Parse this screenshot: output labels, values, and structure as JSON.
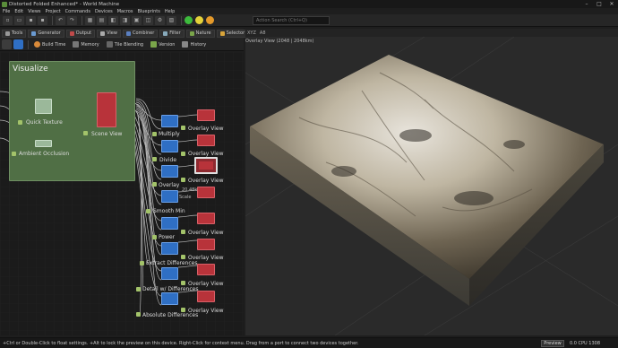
{
  "window": {
    "title": "Distorted Folded Enhanced* - World Machine"
  },
  "menu": [
    "File",
    "Edit",
    "Views",
    "Project",
    "Commands",
    "Devices",
    "Macros",
    "Blueprints",
    "Help"
  ],
  "search": {
    "placeholder": "Action Search (Ctrl+Q)"
  },
  "tabs": [
    "Tools",
    "Generator",
    "Output",
    "View",
    "Combiner",
    "Filter",
    "Nature",
    "Selector"
  ],
  "subtools": [
    "Build Time",
    "Memory",
    "Tile Blending",
    "Version",
    "History"
  ],
  "viewport": {
    "tools": [
      "XYZ",
      "A8"
    ],
    "title": "Overlay View (2048 | 2048km)"
  },
  "group": {
    "title": "Visualize"
  },
  "nodes": {
    "quick_texture": "Quick Texture",
    "ambient_occlusion": "Ambient Occlusion",
    "scene_view": "Scene View",
    "multiply": "Multiply",
    "divide": "Divide",
    "overlay": "Overlay",
    "smooth_min": "Smooth Min",
    "power": "Power",
    "extract_differences": "Extract Differences",
    "detail_differences": "Detail w/ Differences",
    "absolute_differences": "Absolute Differences",
    "overlay_view": "Overlay View",
    "tooltip1": "20.48km",
    "tooltip2": "Scale"
  },
  "status": {
    "hint": "+Ctrl or Double-Click to float settings. +Alt to lock the preview on this device. Right-Click for context menu. Drag from a port to connect two devices together.",
    "preview": "Preview",
    "cpu": "0.0 CPU 1308"
  },
  "colors": {
    "accent_green": "#7aa54a",
    "node_red": "#b8333a",
    "node_blue": "#2f6fc4",
    "group_bg": "#4a6b42"
  }
}
